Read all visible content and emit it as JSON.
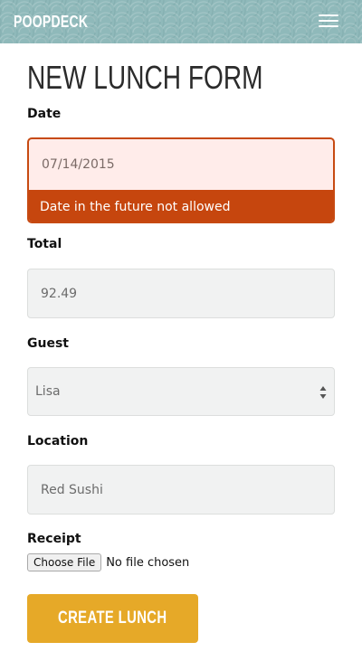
{
  "navbar": {
    "brand": "POOPDECK",
    "menu_icon": "hamburger-menu-icon"
  },
  "form": {
    "title": "NEW LUNCH FORM",
    "date": {
      "label": "Date",
      "value": "07/14/2015",
      "error": "Date in the future not allowed"
    },
    "total": {
      "label": "Total",
      "value": "92.49"
    },
    "guest": {
      "label": "Guest",
      "selected": "Lisa",
      "arrow_icon": "select-updown-icon"
    },
    "location": {
      "label": "Location",
      "value": "Red Sushi"
    },
    "receipt": {
      "label": "Receipt",
      "button_label": "Choose File",
      "status": "No file chosen"
    },
    "submit_label": "CREATE LUNCH"
  },
  "colors": {
    "navbar_bg": "#8fb9ba",
    "error": "#c6460e",
    "error_field_bg": "#ffecea",
    "submit_bg": "#e6a928",
    "field_bg": "#f1f2f2"
  }
}
